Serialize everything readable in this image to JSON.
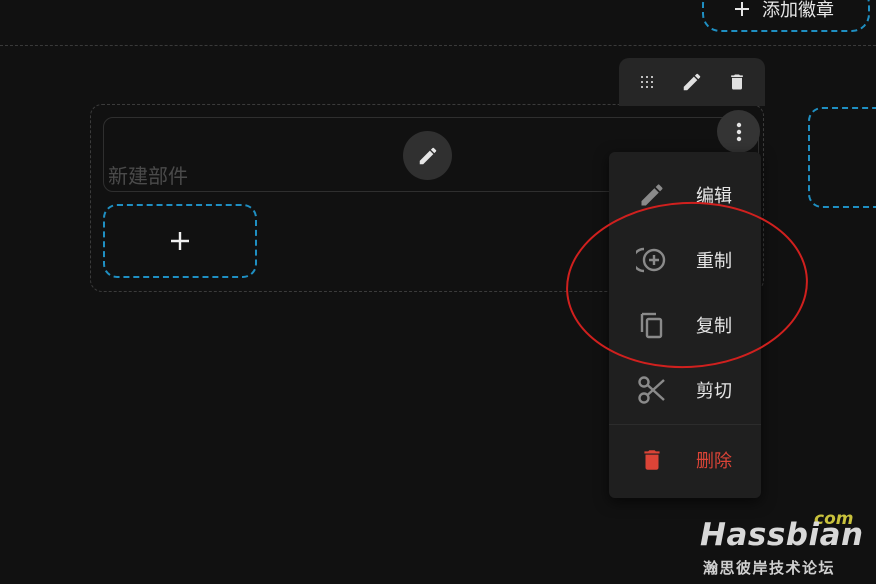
{
  "header": {
    "add_badge_label": "添加徽章"
  },
  "card": {
    "title": "新建部件"
  },
  "toolbar": {
    "icons": [
      "drag-handle-icon",
      "pencil-icon",
      "trash-icon"
    ]
  },
  "menu": {
    "items": [
      {
        "label": "编辑",
        "icon": "pencil-icon"
      },
      {
        "label": "重制",
        "icon": "duplicate-icon"
      },
      {
        "label": "复制",
        "icon": "copy-icon"
      },
      {
        "label": "剪切",
        "icon": "scissors-icon"
      },
      {
        "label": "删除",
        "icon": "trash-icon"
      }
    ]
  },
  "watermark": {
    "domain_suffix": "com",
    "brand": "Hassbian",
    "subtitle": "瀚思彼岸技术论坛"
  },
  "colors": {
    "background": "#111111",
    "accent_dashed": "#1f8fc2",
    "danger": "#db4437",
    "annotation": "#d0201e",
    "menu_bg": "#1f1f1f"
  }
}
